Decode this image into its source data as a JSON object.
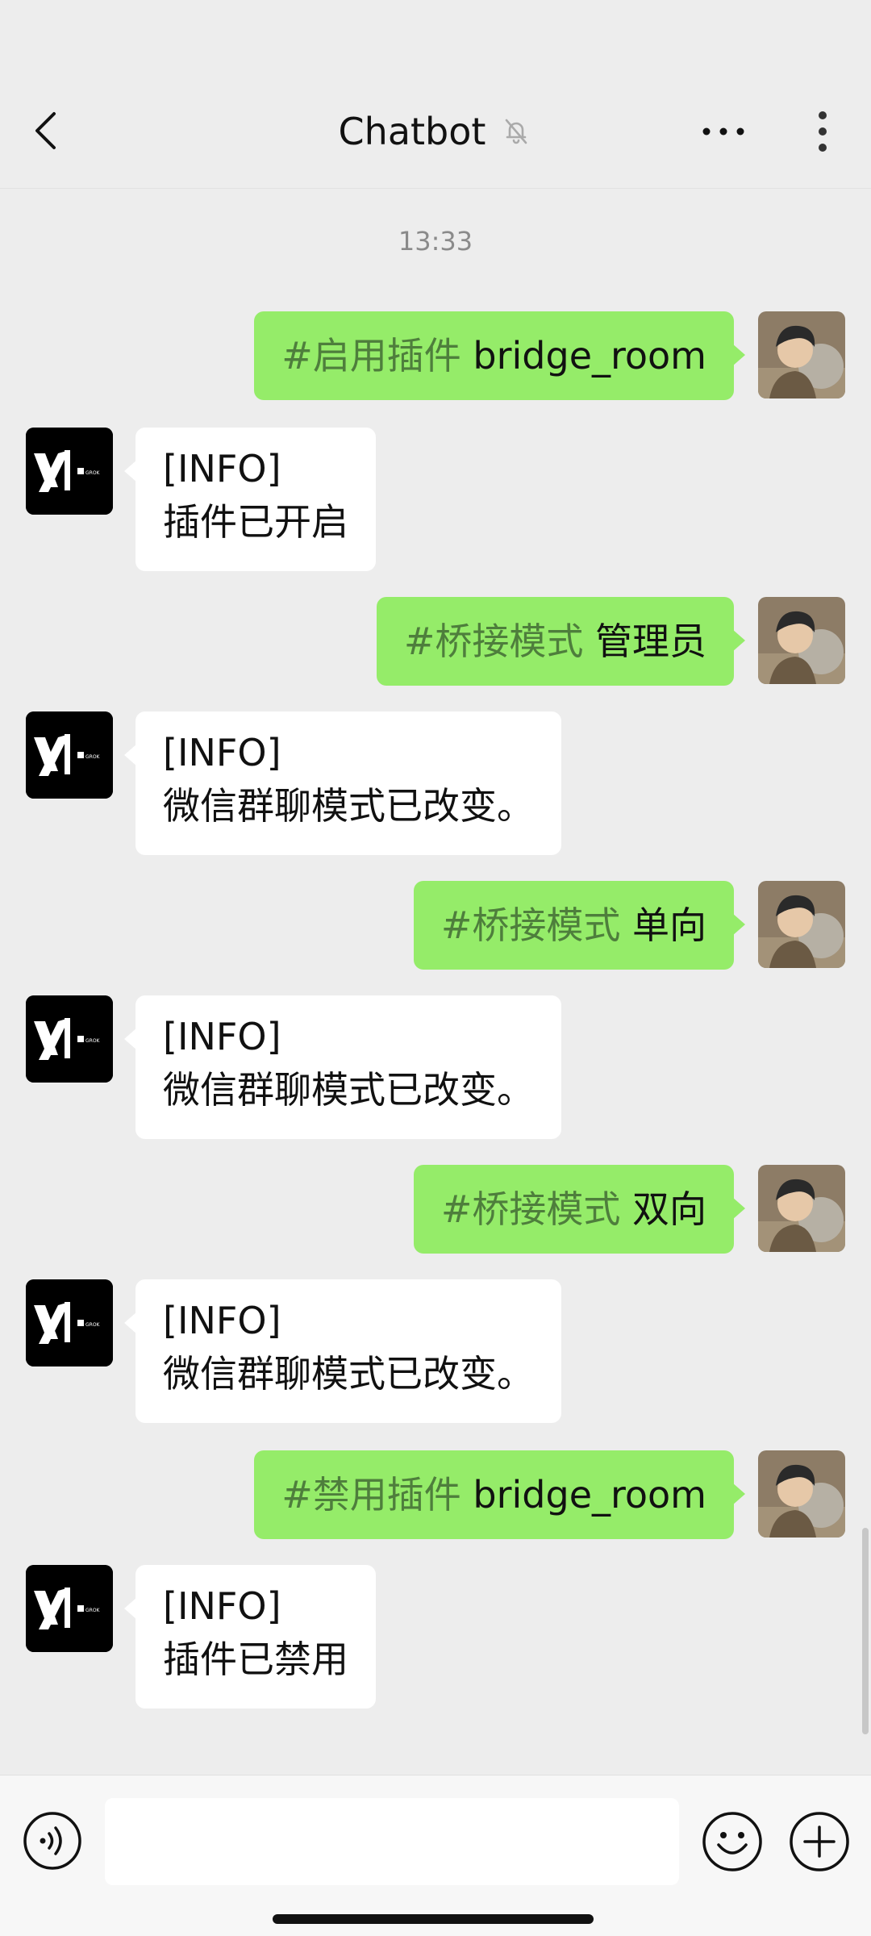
{
  "header": {
    "title": "Chatbot",
    "mute_icon": "bell-off-icon",
    "back_icon": "chevron-left-icon",
    "more_icon": "more-horizontal-icon",
    "menu_icon": "more-vertical-icon"
  },
  "timestamp": "13:33",
  "messages": [
    {
      "side": "out",
      "tag": "#启用插件",
      "text": " bridge_room"
    },
    {
      "side": "in",
      "line1": "[INFO]",
      "line2": "插件已开启"
    },
    {
      "side": "out",
      "tag": "#桥接模式",
      "text": " 管理员"
    },
    {
      "side": "in",
      "line1": "[INFO]",
      "line2": "微信群聊模式已改变。"
    },
    {
      "side": "out",
      "tag": "#桥接模式",
      "text": " 单向"
    },
    {
      "side": "in",
      "line1": "[INFO]",
      "line2": "微信群聊模式已改变。"
    },
    {
      "side": "out",
      "tag": "#桥接模式",
      "text": " 双向"
    },
    {
      "side": "in",
      "line1": "[INFO]",
      "line2": "微信群聊模式已改变。"
    },
    {
      "side": "out",
      "tag": "#禁用插件",
      "text": " bridge_room"
    },
    {
      "side": "in",
      "line1": "[INFO]",
      "line2": "插件已禁用"
    }
  ],
  "bot_avatar": {
    "logo_text": "GROK"
  },
  "input": {
    "value": "",
    "voice_icon": "voice-icon",
    "emoji_icon": "emoji-icon",
    "plus_icon": "plus-circle-icon"
  },
  "colors": {
    "background": "#ededed",
    "outgoing_bubble": "#95ec69",
    "incoming_bubble": "#ffffff",
    "tag_text": "#4e7e3c"
  }
}
